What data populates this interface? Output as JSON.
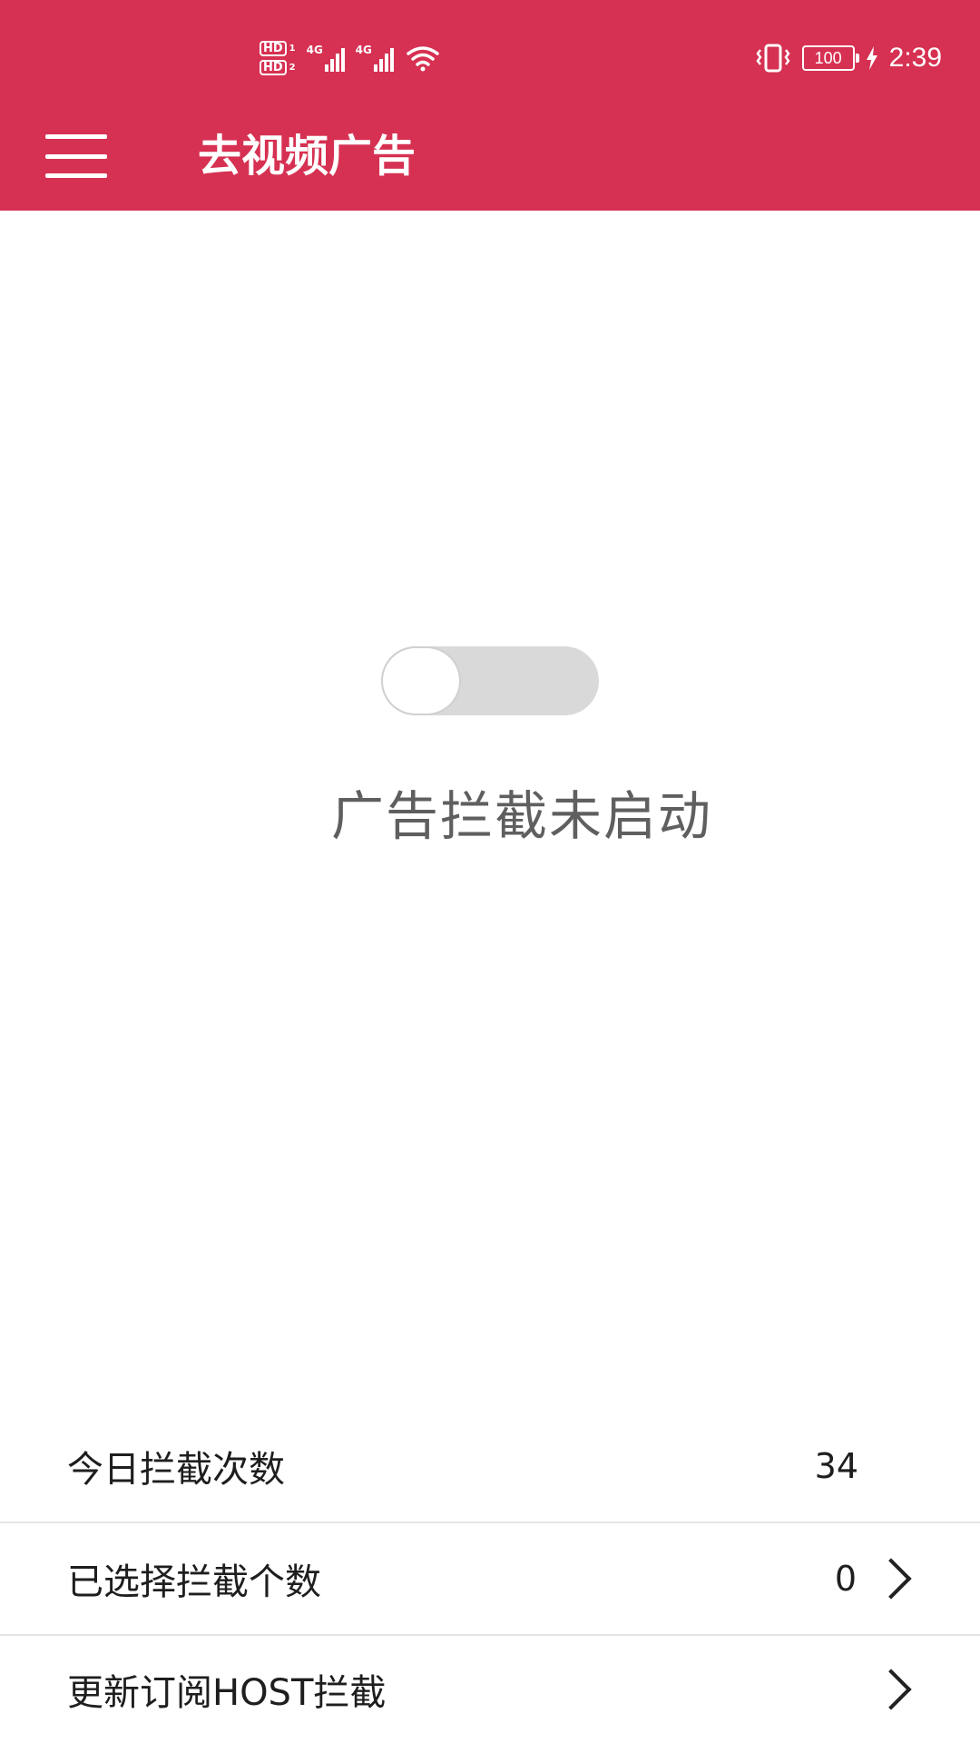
{
  "status_bar": {
    "sim1": "HD",
    "sim1_num": "1",
    "sim2": "HD",
    "sim2_num": "2",
    "network1": "4G",
    "network2": "4G",
    "battery_level": "100",
    "time": "2:39",
    "icons": [
      "signal-icon",
      "signal-icon",
      "wifi-icon",
      "vibrate-icon",
      "battery-icon",
      "charging-icon"
    ]
  },
  "app_bar": {
    "title": "去视频广告",
    "menu_icon": "hamburger-menu-icon"
  },
  "main": {
    "toggle_state": false,
    "status_text": "广告拦截未启动"
  },
  "list": [
    {
      "label": "今日拦截次数",
      "value": "34"
    },
    {
      "label": "已选择拦截个数",
      "value": "0"
    },
    {
      "label": "更新订阅HOST拦截",
      "value": ""
    }
  ],
  "colors": {
    "header_bg": "#d63152",
    "toggle_off": "#d9d9d9",
    "text_primary": "#1e1e1e",
    "text_status": "#5f5f5f"
  }
}
